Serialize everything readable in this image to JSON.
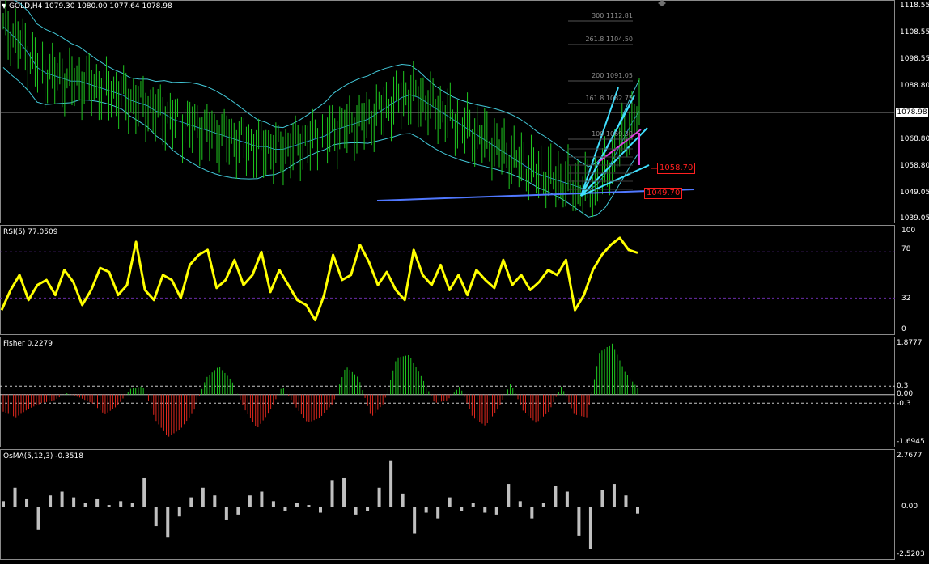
{
  "main": {
    "symbol_label": "GOLD,H4",
    "ohlc": "1079.30 1080.00 1077.64 1078.98",
    "price_axis": [
      "1118.55",
      "1108.55",
      "1098.55",
      "1088.80",
      "1078.98",
      "1068.80",
      "1058.80",
      "1049.05",
      "1039.05"
    ],
    "current_price": "1078.98",
    "fib_levels": [
      {
        "label": "300 1112.81"
      },
      {
        "label": "261.8 1104.50"
      },
      {
        "label": "200 1091.05"
      },
      {
        "label": "161.8 1082.75"
      },
      {
        "label": "100 1069.30"
      }
    ],
    "target_box_1": "1058.70",
    "target_box_2": "1049.70"
  },
  "rsi": {
    "title": "RSI(5) 77.0509",
    "axis": [
      "100",
      "78",
      "32",
      "0"
    ]
  },
  "fisher": {
    "title": "Fisher 0.2279",
    "axis": [
      "1.8777",
      "0.3",
      "0.00",
      "-0.3",
      "-1.6945"
    ]
  },
  "osma": {
    "title": "OsMA(5,12,3) -0.3518",
    "axis": [
      "2.7677",
      "0.00",
      "-2.5203"
    ]
  },
  "colors": {
    "candles": "#1fc81f",
    "bands": "#42c8d8",
    "rsi": "#ffff00",
    "fisher_up": "#1fc81f",
    "fisher_down": "#e0281e",
    "osma": "#c0c0c0",
    "trend_line": "#5078ff",
    "magenta": "#e040e0",
    "cyan_line": "#40e0ff"
  },
  "chart_data": [
    {
      "type": "line",
      "title": "GOLD,H4",
      "series": [
        {
          "name": "GOLD,H4",
          "values": [
            1110,
            1107,
            1104,
            1100,
            1095,
            1093,
            1092,
            1091,
            1090,
            1090,
            1089,
            1088,
            1087,
            1086,
            1085,
            1083,
            1082,
            1081,
            1079,
            1078,
            1076,
            1075,
            1074,
            1073,
            1072,
            1071,
            1070,
            1069,
            1068,
            1067,
            1066,
            1066,
            1065,
            1065,
            1066,
            1067,
            1068,
            1069,
            1070,
            1072,
            1073,
            1074,
            1075,
            1076,
            1078,
            1080,
            1082,
            1084,
            1085,
            1084,
            1082,
            1080,
            1078,
            1076,
            1074,
            1072,
            1070,
            1068,
            1066,
            1064,
            1062,
            1060,
            1058,
            1056,
            1055,
            1054,
            1053,
            1052,
            1051,
            1050,
            1052,
            1056,
            1062,
            1068,
            1074,
            1079
          ]
        }
      ],
      "ylim": [
        1039.05,
        1118.55
      ]
    },
    {
      "type": "line",
      "title": "RSI(5) 77.0509",
      "series": [
        {
          "name": "RSI(5)",
          "values": [
            20,
            40,
            55,
            30,
            45,
            50,
            35,
            60,
            48,
            25,
            40,
            62,
            58,
            35,
            45,
            88,
            40,
            30,
            55,
            50,
            32,
            65,
            75,
            80,
            42,
            50,
            70,
            45,
            55,
            78,
            38,
            60,
            45,
            30,
            25,
            10,
            35,
            75,
            50,
            55,
            85,
            68,
            45,
            58,
            40,
            30,
            80,
            55,
            45,
            65,
            40,
            55,
            35,
            60,
            50,
            42,
            70,
            45,
            55,
            40,
            48,
            60,
            55,
            70,
            20,
            35,
            60,
            75,
            85,
            92,
            80,
            77
          ]
        }
      ],
      "ylim": [
        0,
        100
      ]
    },
    {
      "type": "bar",
      "title": "Fisher 0.2279",
      "series": [
        {
          "name": "Fisher",
          "values": [
            -0.6,
            -0.8,
            -0.5,
            -0.3,
            -0.2,
            0.05,
            -0.1,
            -0.3,
            -0.7,
            -0.4,
            0.2,
            0.3,
            -0.9,
            -1.5,
            -1.2,
            -0.6,
            0.6,
            1.0,
            0.5,
            -0.5,
            -1.2,
            -0.6,
            0.3,
            -0.4,
            -1.0,
            -0.8,
            -0.3,
            1.0,
            0.6,
            -0.8,
            -0.3,
            1.3,
            1.4,
            0.6,
            -0.3,
            -0.2,
            0.3,
            -0.8,
            -1.1,
            -0.5,
            0.4,
            -0.6,
            -1.0,
            -0.6,
            0.3,
            -0.7,
            -0.8,
            1.5,
            1.8,
            0.8,
            0.23
          ]
        }
      ],
      "ylim": [
        -1.6945,
        1.8777
      ]
    },
    {
      "type": "bar",
      "title": "OsMA(5,12,3) -0.3518",
      "series": [
        {
          "name": "OsMA",
          "values": [
            0.3,
            1.0,
            0.4,
            -1.2,
            0.6,
            0.8,
            0.5,
            0.2,
            0.4,
            0.1,
            0.3,
            0.2,
            1.5,
            -1.0,
            -1.6,
            -0.5,
            0.5,
            1.0,
            0.6,
            -0.7,
            -0.4,
            0.6,
            0.8,
            0.3,
            -0.2,
            0.2,
            0.1,
            -0.3,
            1.4,
            1.5,
            -0.4,
            -0.2,
            1.0,
            2.4,
            0.7,
            -1.4,
            -0.3,
            -0.6,
            0.5,
            -0.2,
            0.2,
            -0.3,
            -0.4,
            1.2,
            0.3,
            -0.6,
            0.2,
            1.1,
            0.8,
            -1.5,
            -2.2,
            0.9,
            1.2,
            0.6,
            -0.35
          ]
        }
      ],
      "ylim": [
        -2.5203,
        2.7677
      ]
    }
  ]
}
